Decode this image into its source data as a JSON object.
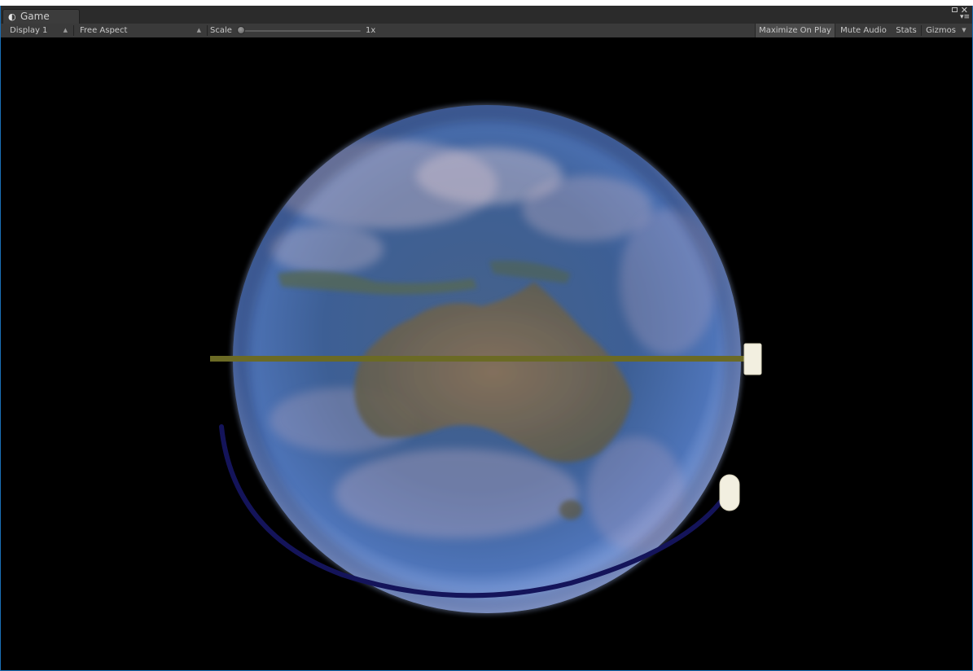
{
  "window": {
    "tab_title": "Game",
    "tab_icon": "unity-logo-icon"
  },
  "toolbar": {
    "display": "Display 1",
    "aspect": "Free Aspect",
    "scale_label": "Scale",
    "scale_value": "1x",
    "maximize_on_play": "Maximize On Play",
    "mute_audio": "Mute Audio",
    "stats": "Stats",
    "gizmos": "Gizmos"
  },
  "scene": {
    "background": "#000000",
    "earth_color": "#3d5f95",
    "equator_bar_color": "#6b6a25",
    "orbit_path_color": "#14145a",
    "marker_color": "#f2efe0"
  }
}
